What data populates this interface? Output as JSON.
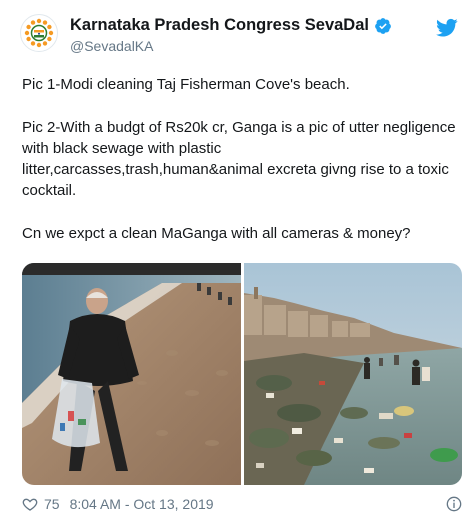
{
  "account": {
    "display_name": "Karnataka Pradesh Congress SevaDal",
    "handle": "@SevadalKA",
    "verified": true,
    "avatar_icon": "sevadal-logo-icon"
  },
  "tweet": {
    "paragraphs": [
      "Pic 1-Modi cleaning Taj Fisherman Cove's beach.",
      "Pic 2-With a budgt of Rs20k cr, Ganga is a pic of utter negligence with black sewage with plastic litter,carcasses,trash,human&animal excreta givng rise to a toxic cocktail.",
      "Cn we expct a clean MaGanga with all cameras & money?"
    ]
  },
  "media": {
    "photos": [
      "beach-cleanup-photo",
      "ganga-riverbank-photo"
    ]
  },
  "footer": {
    "likes": "75",
    "timestamp": "8:04 AM - Oct 13, 2019"
  },
  "colors": {
    "twitter_blue": "#1da1f2",
    "text_primary": "#14171a",
    "text_secondary": "#657786",
    "verified_badge": "#1da1f2"
  }
}
